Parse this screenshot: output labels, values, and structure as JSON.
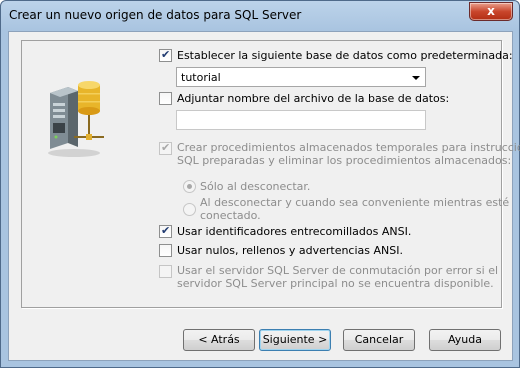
{
  "window": {
    "title": "Crear un nuevo origen de datos para SQL Server",
    "close_label": "x"
  },
  "options": {
    "default_db": {
      "label": "Establecer la siguiente base de datos como predeterminada:",
      "checked": true
    },
    "db_select": {
      "value": "tutorial"
    },
    "attach_file": {
      "label": "Adjuntar nombre del archivo de la base de datos:",
      "checked": false
    },
    "attach_file_input": {
      "value": ""
    },
    "temp_procs": {
      "line1": "Crear procedimientos almacenados temporales para instrucciones",
      "line2": "SQL preparadas y eliminar los procedimientos almacenados:",
      "checked": true,
      "enabled": false
    },
    "radio_disconnect": {
      "label": "Sólo al desconectar.",
      "selected": true
    },
    "radio_disconnect_safe": {
      "line1": "Al desconectar y cuando sea conveniente mientras esté",
      "line2": "conectado.",
      "selected": false
    },
    "ansi_quoted": {
      "label": "Usar identificadores entrecomillados ANSI.",
      "checked": true
    },
    "ansi_nulls": {
      "label": "Usar nulos, rellenos y advertencias ANSI.",
      "checked": false
    },
    "failover": {
      "line1": "Usar el servidor SQL Server de conmutación por error si el",
      "line2": "servidor SQL Server principal no se encuentra disponible.",
      "checked": false,
      "enabled": false
    }
  },
  "buttons": {
    "back": "< Atrás",
    "next": "Siguiente >",
    "cancel": "Cancelar",
    "help": "Ayuda"
  },
  "icons": [
    "server-database-icon",
    "checkmark-icon",
    "close-icon"
  ]
}
